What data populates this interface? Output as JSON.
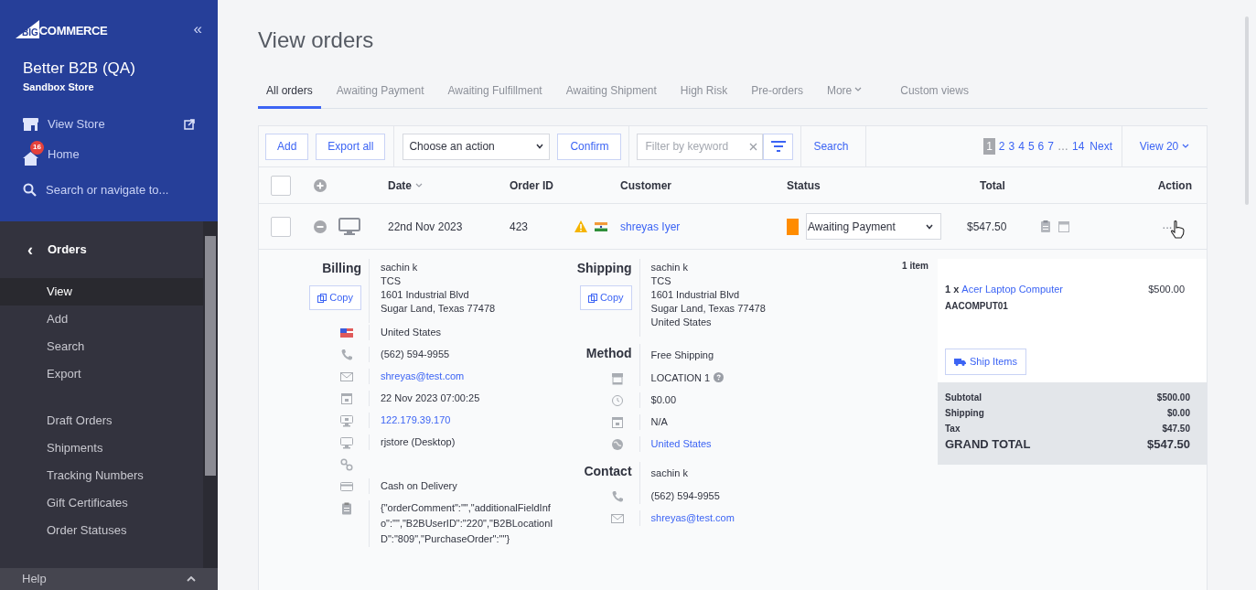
{
  "sidebar": {
    "logo": {
      "mark": "BIG",
      "word": "COMMERCE"
    },
    "collapse": "«",
    "store_name": "Better B2B (QA)",
    "store_type": "Sandbox Store",
    "links": [
      {
        "kind": "store",
        "label": "View Store",
        "external": true
      },
      {
        "kind": "home",
        "label": "Home",
        "badge": "16"
      },
      {
        "kind": "search",
        "label": "Search or navigate to..."
      }
    ],
    "section": "Orders",
    "back": "‹",
    "item_groups": [
      [
        {
          "label": "View",
          "selected": true
        },
        {
          "label": "Add",
          "selected": false
        },
        {
          "label": "Search",
          "selected": false
        },
        {
          "label": "Export",
          "selected": false
        }
      ],
      [
        {
          "label": "Draft Orders",
          "selected": false
        },
        {
          "label": "Shipments",
          "selected": false
        },
        {
          "label": "Tracking Numbers",
          "selected": false
        },
        {
          "label": "Gift Certificates",
          "selected": false
        },
        {
          "label": "Order Statuses",
          "selected": false
        }
      ]
    ],
    "help": "Help"
  },
  "page_title": "View orders",
  "tabs": [
    {
      "label": "All orders",
      "selected": true
    },
    {
      "label": "Awaiting Payment",
      "selected": false
    },
    {
      "label": "Awaiting Fulfillment",
      "selected": false
    },
    {
      "label": "Awaiting Shipment",
      "selected": false
    },
    {
      "label": "High Risk",
      "selected": false
    },
    {
      "label": "Pre-orders",
      "selected": false
    },
    {
      "label": "More",
      "selected": false,
      "kind": "menu"
    },
    {
      "label": "Custom views",
      "selected": false
    }
  ],
  "toolbar": {
    "buttons": [
      "Add",
      "Export all"
    ],
    "action_select": "Choose an action",
    "confirm": "Confirm",
    "filter_placeholder": "Filter by keyword",
    "search": "Search",
    "pages": [
      {
        "label": "1",
        "selected": true
      },
      {
        "label": "2",
        "selected": false
      },
      {
        "label": "3",
        "selected": false
      },
      {
        "label": "4",
        "selected": false
      },
      {
        "label": "5",
        "selected": false
      },
      {
        "label": "6",
        "selected": false
      },
      {
        "label": "7",
        "selected": false
      },
      {
        "label": "…",
        "selected": false
      },
      {
        "label": "14",
        "selected": false
      }
    ],
    "next": "Next",
    "view": "View 20"
  },
  "table": {
    "select_all_checked": false,
    "columns": [
      "Date",
      "Order ID",
      "Customer",
      "Status",
      "Total",
      "Action"
    ],
    "rows": [
      {
        "date": "22nd Nov 2023",
        "order_id": "423",
        "customer": "shreyas Iyer",
        "status": "Awaiting Payment",
        "color": "#ff8c00",
        "total": "$547.50",
        "expanded": true,
        "action": "···",
        "checked": false
      }
    ]
  },
  "details": {
    "billing": {
      "heading": "Billing",
      "copy": "Copy",
      "address": [
        "sachin k",
        "TCS",
        "1601 Industrial Blvd",
        "Sugar Land, Texas 77478"
      ],
      "fields": [
        {
          "kind": "flag",
          "value": "United States"
        },
        {
          "kind": "phone",
          "value": "(562) 594-9955"
        },
        {
          "kind": "email",
          "value": "shreyas@test.com",
          "link": true
        },
        {
          "kind": "calendar",
          "value": "22 Nov 2023 07:00:25"
        },
        {
          "kind": "ip",
          "value": "122.179.39.170",
          "link": true
        },
        {
          "kind": "device",
          "value": "rjstore (Desktop)"
        },
        {
          "kind": "link"
        },
        {
          "kind": "card",
          "value": "Cash on Delivery"
        },
        {
          "kind": "note",
          "value": "{\"orderComment\":\"\",\"additionalFieldInfo\":\"\",\"B2BUserID\":\"220\",\"B2BLocationID\":\"809\",\"PurchaseOrder\":\"\"}"
        }
      ]
    },
    "shipping": {
      "heading": "Shipping",
      "copy": "Copy",
      "address": [
        "sachin k",
        "TCS",
        "1601 Industrial Blvd",
        "Sugar Land, Texas 77478",
        "United States"
      ]
    },
    "method": {
      "heading": "Method",
      "value": "Free Shipping",
      "fields": [
        {
          "kind": "store",
          "value": "LOCATION 1",
          "help": true
        },
        {
          "kind": "clock",
          "value": "$0.00"
        },
        {
          "kind": "calendar",
          "value": "N/A"
        },
        {
          "kind": "globe",
          "value": "United States",
          "link": true
        }
      ]
    },
    "contact": {
      "heading": "Contact",
      "value": "sachin k",
      "fields": [
        {
          "kind": "phone",
          "value": "(562) 594-9955"
        },
        {
          "kind": "email",
          "value": "shreyas@test.com",
          "link": true
        }
      ]
    },
    "items": {
      "count": "1 item",
      "products": [
        {
          "qty": "1 x",
          "name": "Acer Laptop Computer",
          "sku": "AACOMPUT01",
          "price": "$500.00"
        }
      ],
      "ship_button": "Ship Items",
      "totals": [
        {
          "label": "Subtotal",
          "value": "$500.00"
        },
        {
          "label": "Shipping",
          "value": "$0.00"
        },
        {
          "label": "Tax",
          "value": "$47.50"
        }
      ],
      "grand_total": {
        "label": "GRAND TOTAL",
        "value": "$547.50"
      }
    }
  }
}
